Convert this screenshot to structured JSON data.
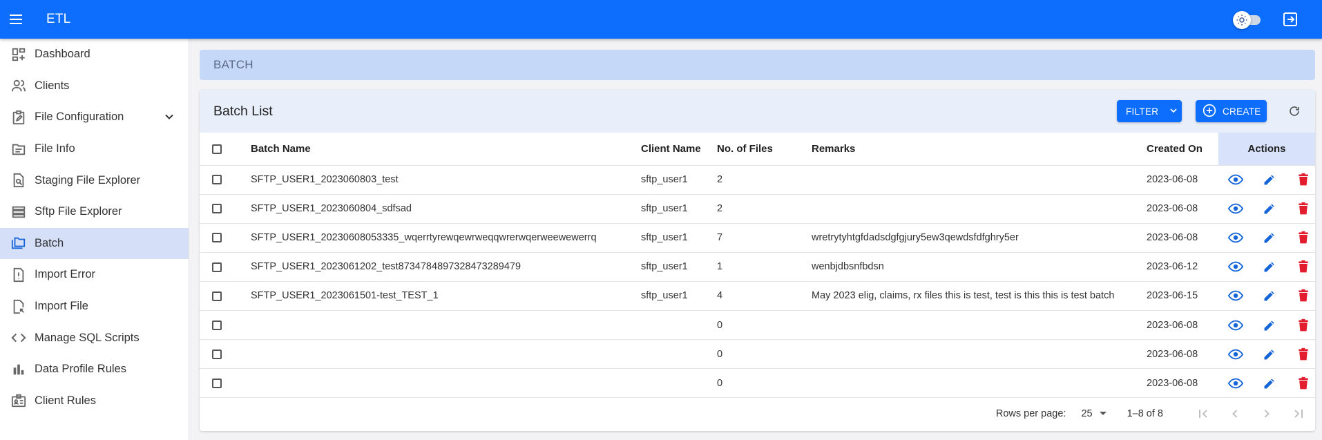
{
  "app": {
    "title": "ETL"
  },
  "header": {
    "menu_icon": "menu-icon",
    "theme_icon": "sun-icon",
    "logout_icon": "logout-icon"
  },
  "sidebar": {
    "items": [
      {
        "label": "Dashboard",
        "icon": "dashboard-icon"
      },
      {
        "label": "Clients",
        "icon": "people-icon"
      },
      {
        "label": "File Configuration",
        "icon": "clipboard-edit-icon",
        "expandable": true
      },
      {
        "label": "File Info",
        "icon": "file-info-icon"
      },
      {
        "label": "Staging File Explorer",
        "icon": "file-search-icon"
      },
      {
        "label": "Sftp File Explorer",
        "icon": "storage-icon"
      },
      {
        "label": "Batch",
        "icon": "folder-copy-icon",
        "active": true
      },
      {
        "label": "Import Error",
        "icon": "error-file-icon"
      },
      {
        "label": "Import File",
        "icon": "import-file-icon"
      },
      {
        "label": "Manage SQL Scripts",
        "icon": "code-icon"
      },
      {
        "label": "Data Profile Rules",
        "icon": "bar-chart-icon"
      },
      {
        "label": "Client Rules",
        "icon": "badge-icon"
      }
    ]
  },
  "breadcrumb": {
    "text": "BATCH"
  },
  "card": {
    "title": "Batch List",
    "filter_label": "FILTER",
    "create_label": "CREATE"
  },
  "table": {
    "columns": {
      "batch_name": "Batch Name",
      "client_name": "Client Name",
      "files": "No. of Files",
      "remarks": "Remarks",
      "created_on": "Created On",
      "actions": "Actions"
    },
    "rows": [
      {
        "batch_name": "SFTP_USER1_2023060803_test",
        "client_name": "sftp_user1",
        "files": "2",
        "remarks": "",
        "created_on": "2023-06-08"
      },
      {
        "batch_name": "SFTP_USER1_2023060804_sdfsad",
        "client_name": "sftp_user1",
        "files": "2",
        "remarks": "",
        "created_on": "2023-06-08"
      },
      {
        "batch_name": "SFTP_USER1_20230608053335_wqerrtyrewqewrweqqwrerwqerweewewerrq",
        "client_name": "sftp_user1",
        "files": "7",
        "remarks": "wretrytyhtgfdadsdgfgjury5ew3qewdsfdfghry5er",
        "created_on": "2023-06-08"
      },
      {
        "batch_name": "SFTP_USER1_2023061202_test873478489732847328947​9",
        "client_name": "sftp_user1",
        "files": "1",
        "remarks": "wenbjdbsnfbdsn",
        "created_on": "2023-06-12"
      },
      {
        "batch_name": "SFTP_USER1_2023061501-test_TEST_1",
        "client_name": "sftp_user1",
        "files": "4",
        "remarks": "May 2023 elig, claims, rx files this is test, test is this this is test batch",
        "created_on": "2023-06-15"
      },
      {
        "batch_name": "",
        "client_name": "",
        "files": "0",
        "remarks": "",
        "created_on": "2023-06-08"
      },
      {
        "batch_name": "",
        "client_name": "",
        "files": "0",
        "remarks": "",
        "created_on": "2023-06-08"
      },
      {
        "batch_name": "",
        "client_name": "",
        "files": "0",
        "remarks": "",
        "created_on": "2023-06-08"
      }
    ]
  },
  "pagination": {
    "rows_per_page_label": "Rows per page:",
    "rows_per_page_value": "25",
    "range": "1–8 of 8"
  },
  "colors": {
    "primary": "#0d6efd",
    "sidebar_active": "#d6dff8",
    "breadcrumb_bg": "#c6d8f7",
    "delete": "#e11d2e",
    "action_blue": "#1565d8"
  }
}
